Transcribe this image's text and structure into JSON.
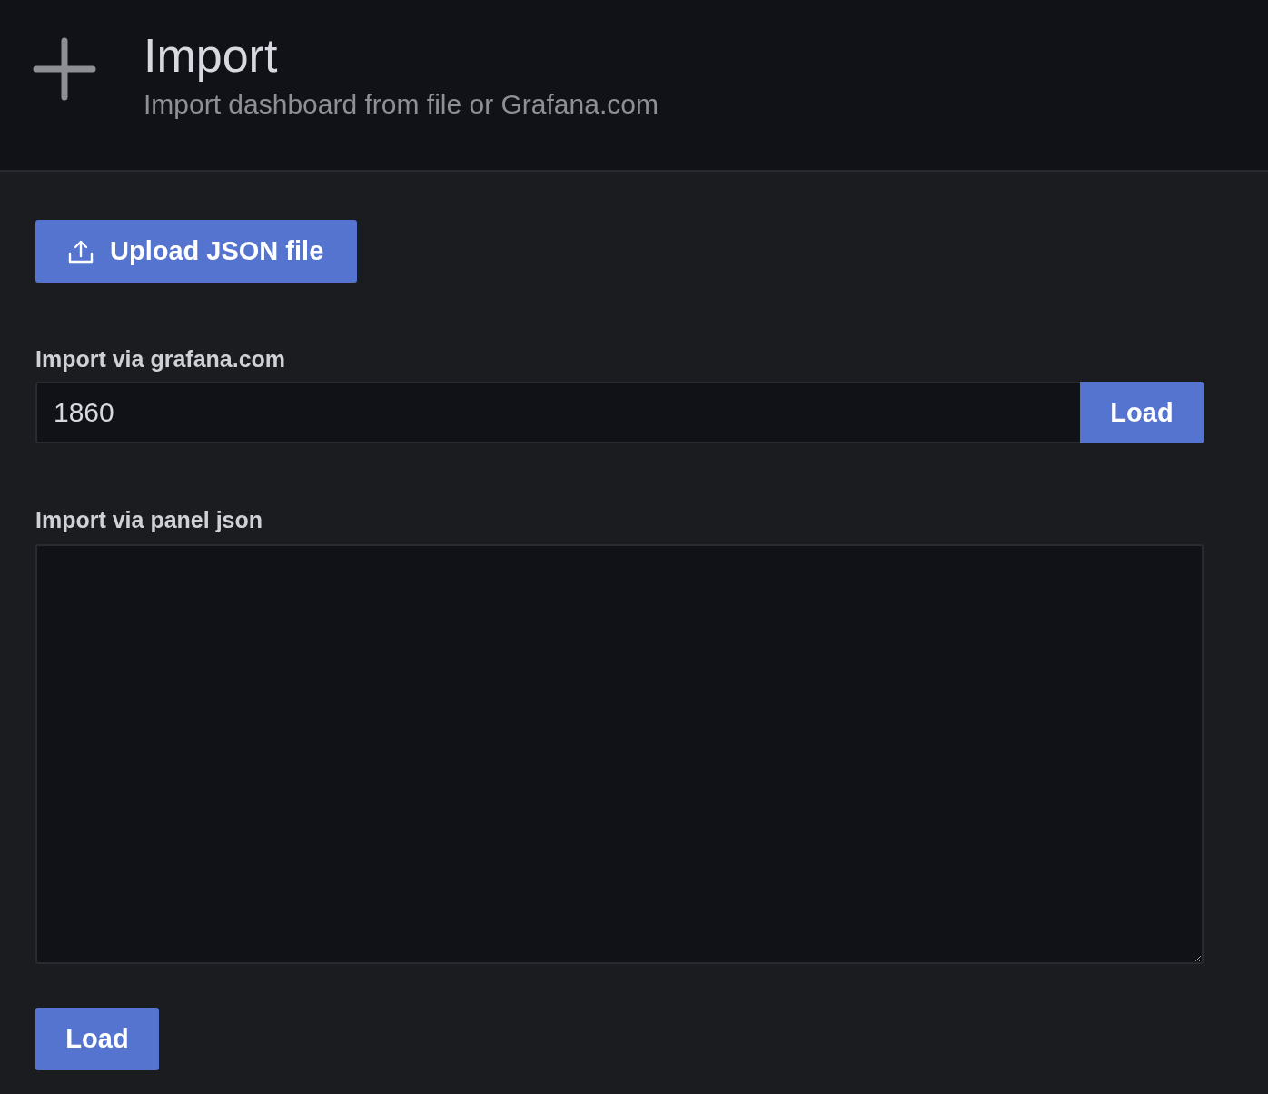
{
  "header": {
    "title": "Import",
    "subtitle": "Import dashboard from file or Grafana.com"
  },
  "upload_button": {
    "label": "Upload JSON file"
  },
  "grafana_import": {
    "label": "Import via grafana.com",
    "value": "1860",
    "button": "Load"
  },
  "panel_json": {
    "label": "Import via panel json",
    "button": "Load"
  }
}
